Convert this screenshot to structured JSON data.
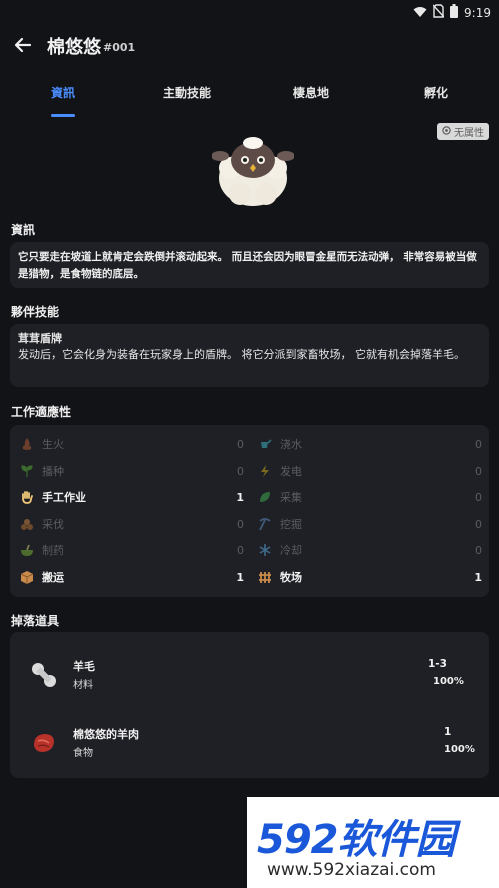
{
  "status": {
    "time": "9:19"
  },
  "header": {
    "title": "棉悠悠",
    "number": "#001"
  },
  "tabs": [
    {
      "label": "資訊",
      "active": true
    },
    {
      "label": "主動技能",
      "active": false
    },
    {
      "label": "棲息地",
      "active": false
    },
    {
      "label": "孵化",
      "active": false
    }
  ],
  "element_badge": "无属性",
  "info": {
    "title": "資訊",
    "text": "它只要走在坡道上就肯定会跌倒并滚动起来。 而且还会因为眼冒金星而无法动弹， 非常容易被当做是猎物，是食物链的底层。"
  },
  "partner_skill": {
    "title": "夥伴技能",
    "name": "茸茸盾牌",
    "desc": "发动后，它会化身为装备在玩家身上的盾牌。 将它分派到家畜牧场， 它就有机会掉落羊毛。"
  },
  "work": {
    "title": "工作適應性",
    "left": [
      {
        "label": "生火",
        "value": "0",
        "icon": "fire-icon"
      },
      {
        "label": "播种",
        "value": "0",
        "icon": "sprout-icon"
      },
      {
        "label": "手工作业",
        "value": "1",
        "icon": "hand-icon"
      },
      {
        "label": "采伐",
        "value": "0",
        "icon": "logs-icon"
      },
      {
        "label": "制药",
        "value": "0",
        "icon": "mortar-icon"
      },
      {
        "label": "搬运",
        "value": "1",
        "icon": "box-icon"
      }
    ],
    "right": [
      {
        "label": "浇水",
        "value": "0",
        "icon": "watering-can-icon"
      },
      {
        "label": "发电",
        "value": "0",
        "icon": "lightning-icon"
      },
      {
        "label": "采集",
        "value": "0",
        "icon": "leaf-icon"
      },
      {
        "label": "挖掘",
        "value": "0",
        "icon": "pickaxe-icon"
      },
      {
        "label": "冷却",
        "value": "0",
        "icon": "snowflake-icon"
      },
      {
        "label": "牧场",
        "value": "1",
        "icon": "fence-icon"
      }
    ]
  },
  "drops": {
    "title": "掉落道具",
    "items": [
      {
        "name": "羊毛",
        "type": "材料",
        "qty": "1-3",
        "rate": "100%",
        "icon": "wool-icon"
      },
      {
        "name": "棉悠悠的羊肉",
        "type": "食物",
        "qty": "1",
        "rate": "100%",
        "icon": "meat-icon"
      }
    ]
  },
  "watermark": {
    "logo": "592软件园",
    "url": "www.592xiazai.com"
  }
}
